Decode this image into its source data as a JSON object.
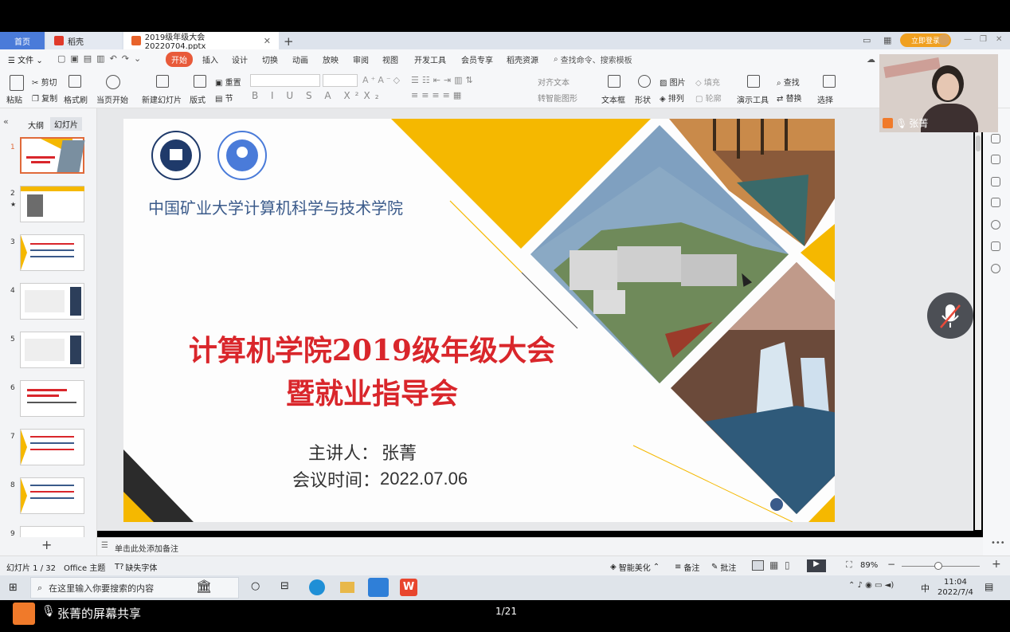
{
  "tabs": {
    "home": "首页",
    "daoke": "稻壳",
    "file": "2019级年级大会20220704.pptx"
  },
  "login_button": "立即登录",
  "menu": {
    "file": "文件",
    "items": [
      "开始",
      "插入",
      "设计",
      "切换",
      "动画",
      "放映",
      "审阅",
      "视图",
      "开发工具",
      "会员专享",
      "稻壳资源"
    ],
    "search": "查找命令、搜索模板"
  },
  "ribbon": {
    "paste": "粘贴",
    "cut": "剪切",
    "copy": "复制",
    "format_painter": "格式刷",
    "from_current": "当页开始",
    "new_slide": "新建幻灯片",
    "layout": "版式",
    "section": "节",
    "reset": "重置",
    "align_text": "对齐文本",
    "convert_smartart": "转智能图形",
    "textbox": "文本框",
    "shape": "形状",
    "picture": "图片",
    "arrange": "排列",
    "fill": "填充",
    "outline": "轮廓",
    "present_tools": "演示工具",
    "find": "查找",
    "replace": "替换",
    "select": "选择"
  },
  "left_panel": {
    "outline_tab": "大纲",
    "slides_tab": "幻灯片",
    "numbers": [
      "1",
      "2",
      "3",
      "4",
      "5",
      "6",
      "7",
      "8",
      "9"
    ]
  },
  "slide": {
    "school": "中国矿业大学计算机科学与技术学院",
    "title_line1": "计算机学院2019级年级大会",
    "title_line2": "暨就业指导会",
    "speaker_label": "主讲人：",
    "speaker": "张菁",
    "time_label": "会议时间：",
    "time": "2022.07.06"
  },
  "video": {
    "name": "张菁"
  },
  "notes_placeholder": "单击此处添加备注",
  "status": {
    "slide_counter": "幻灯片 1 / 32",
    "theme": "Office 主题",
    "missing_font": "缺失字体",
    "smart_beautify": "智能美化",
    "notes": "备注",
    "comments": "批注",
    "zoom": "89%"
  },
  "taskbar": {
    "search_placeholder": "在这里输入你要搜索的内容",
    "ime": "中",
    "time": "11:04",
    "date": "2022/7/4"
  },
  "share": {
    "label": "张菁的屏幕共享",
    "page": "1/21"
  },
  "colors": {
    "accent_red": "#e85a3a",
    "slide_title_red": "#d9262b",
    "slide_yellow": "#f5b800",
    "school_blue": "#3a5a8a"
  }
}
